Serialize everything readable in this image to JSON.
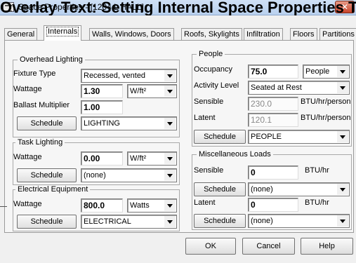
{
  "window": {
    "title": "Space Properties - [1204 L HALL]",
    "overlay_text": "Overlay Text: Setting Internal Space Properties Through Dialog Boxes"
  },
  "tabs": [
    {
      "label": "General"
    },
    {
      "label": "Internals"
    },
    {
      "label": "Walls, Windows, Doors"
    },
    {
      "label": "Roofs, Skylights"
    },
    {
      "label": "Infiltration"
    },
    {
      "label": "Floors"
    },
    {
      "label": "Partitions"
    }
  ],
  "overhead_lighting": {
    "title": "Overhead Lighting",
    "fixture_type_label": "Fixture Type",
    "fixture_type_value": "Recessed, vented",
    "wattage_label": "Wattage",
    "wattage_value": "1.30",
    "wattage_unit": "W/ft²",
    "ballast_label": "Ballast Multiplier",
    "ballast_value": "1.00",
    "schedule_button": "Schedule",
    "schedule_value": "LIGHTING"
  },
  "task_lighting": {
    "title": "Task Lighting",
    "wattage_label": "Wattage",
    "wattage_value": "0.00",
    "wattage_unit": "W/ft²",
    "schedule_button": "Schedule",
    "schedule_value": "(none)"
  },
  "electrical_equipment": {
    "title": "Electrical Equipment",
    "wattage_label": "Wattage",
    "wattage_value": "800.0",
    "wattage_unit": "Watts",
    "schedule_button": "Schedule",
    "schedule_value": "ELECTRICAL"
  },
  "people": {
    "title": "People",
    "occupancy_label": "Occupancy",
    "occupancy_value": "75.0",
    "occupancy_unit": "People",
    "activity_label": "Activity Level",
    "activity_value": "Seated at Rest",
    "sensible_label": "Sensible",
    "sensible_value": "230.0",
    "sensible_unit": "BTU/hr/person",
    "latent_label": "Latent",
    "latent_value": "120.1",
    "latent_unit": "BTU/hr/person",
    "schedule_button": "Schedule",
    "schedule_value": "PEOPLE"
  },
  "misc_loads": {
    "title": "Miscellaneous Loads",
    "sensible_label": "Sensible",
    "sensible_value": "0",
    "sensible_unit": "BTU/hr",
    "sensible_schedule_button": "Schedule",
    "sensible_schedule_value": "(none)",
    "latent_label": "Latent",
    "latent_value": "0",
    "latent_unit": "BTU/hr",
    "latent_schedule_button": "Schedule",
    "latent_schedule_value": "(none)"
  },
  "buttons": {
    "ok": "OK",
    "cancel": "Cancel",
    "help": "Help"
  }
}
